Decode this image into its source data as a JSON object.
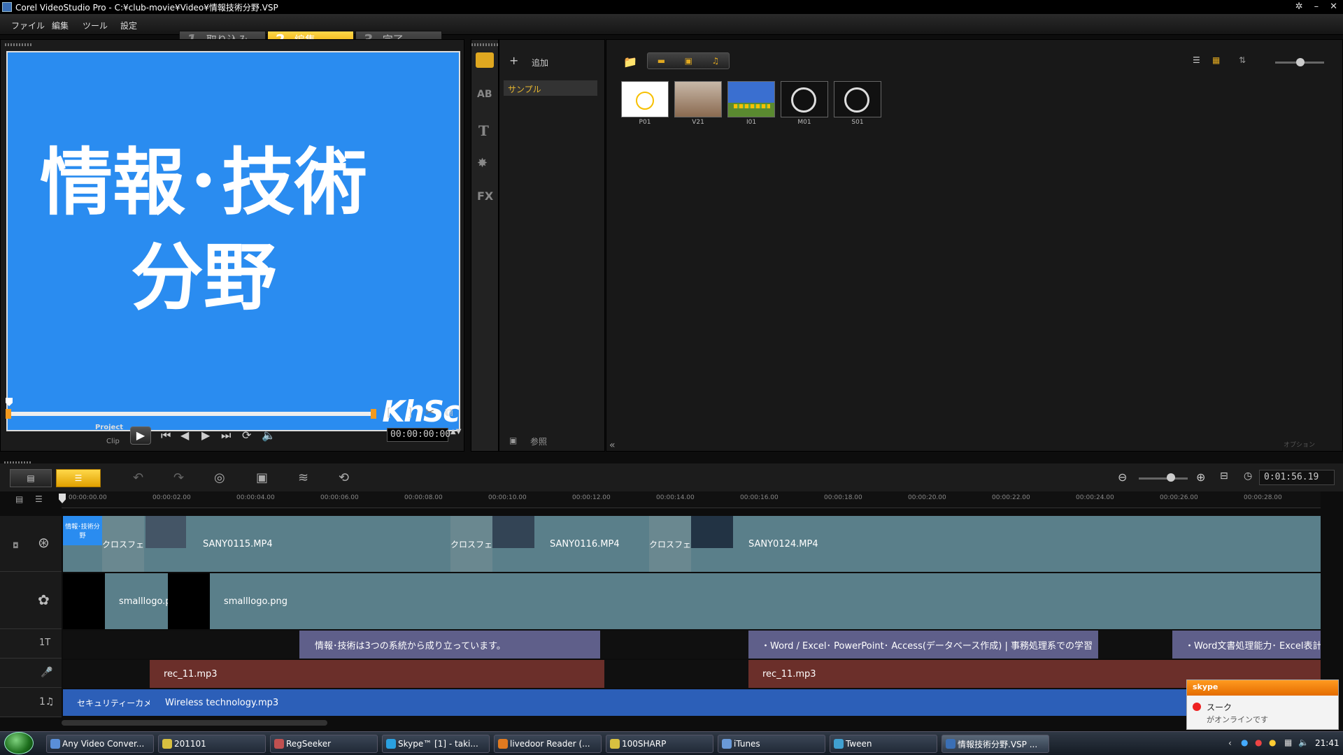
{
  "titlebar": {
    "title": "Corel VideoStudio Pro - C:¥club-movie¥Video¥情報技術分野.VSP"
  },
  "menu": {
    "file": "ファイル",
    "edit": "編集",
    "tools": "ツール",
    "settings": "設定"
  },
  "steps": [
    {
      "num": "1",
      "label": "取り込み"
    },
    {
      "num": "2",
      "label": "編集"
    },
    {
      "num": "3",
      "label": "完了"
    }
  ],
  "preview": {
    "title_line1": "情報･技術",
    "title_line2": "分野",
    "logo": "KhSc",
    "project_label": "Project",
    "clip_label": "Clip",
    "timecode": "00:00:00:00",
    "bg_color": "#2a8cf0"
  },
  "library": {
    "add_label": "追加",
    "folder": "サンプル",
    "browse_label": "参照",
    "options_label": "オプション",
    "thumbs": [
      {
        "label": "P01",
        "icon": "sun-image"
      },
      {
        "label": "V21",
        "icon": "video"
      },
      {
        "label": "I01",
        "icon": "sunflower-image"
      },
      {
        "label": "M01",
        "icon": "music-disc"
      },
      {
        "label": "S01",
        "icon": "music-disc"
      }
    ]
  },
  "timeline": {
    "duration": "0:01:56.19",
    "ruler": [
      "00:00:00.00",
      "00:00:02.00",
      "00:00:04.00",
      "00:00:06.00",
      "00:00:08.00",
      "00:00:10.00",
      "00:00:12.00",
      "00:00:14.00",
      "00:00:16.00",
      "00:00:18.00",
      "00:00:20.00",
      "00:00:22.00",
      "00:00:24.00",
      "00:00:26.00",
      "00:00:28.00"
    ],
    "video": {
      "title_thumb": "情報･技術分野",
      "transition": "クロスフェード",
      "clip1": "SANY0115.MP4",
      "clip2": "SANY0116.MP4",
      "clip3": "SANY0124.MP4"
    },
    "overlay": {
      "clip1": "smalllogo.png",
      "clip2": "smalllogo.png"
    },
    "title": {
      "clip1": "情報･技術は3つの系統から成り立っています。",
      "clip2": "・Word / Excel･ PowerPoint･ Access(データベース作成) | 事務処理系での学習",
      "clip3": "・Word文書処理能力･ Excel表計算"
    },
    "voice": {
      "clip1": "rec_11.mp3",
      "clip2": "rec_11.mp3"
    },
    "music": {
      "clip1": "セキュリティーカメラ",
      "clip2": "Wireless technology.mp3"
    }
  },
  "skype": {
    "brand": "skype",
    "name": "スーク",
    "status": "がオンラインです"
  },
  "taskbar": {
    "items": [
      "Any Video Conver...",
      "201101",
      "RegSeeker",
      "Skype™ [1] - taki...",
      "livedoor Reader (...",
      "100SHARP",
      "iTunes",
      "Tween",
      "情報技術分野.VSP ..."
    ],
    "clock": "21:41"
  },
  "colors": {
    "accent": "#f0b400",
    "video_track": "#5a7f8a",
    "title_clip": "#5f5f8a",
    "voice_clip": "#6b2f2a",
    "music_clip": "#2c5fb8"
  }
}
